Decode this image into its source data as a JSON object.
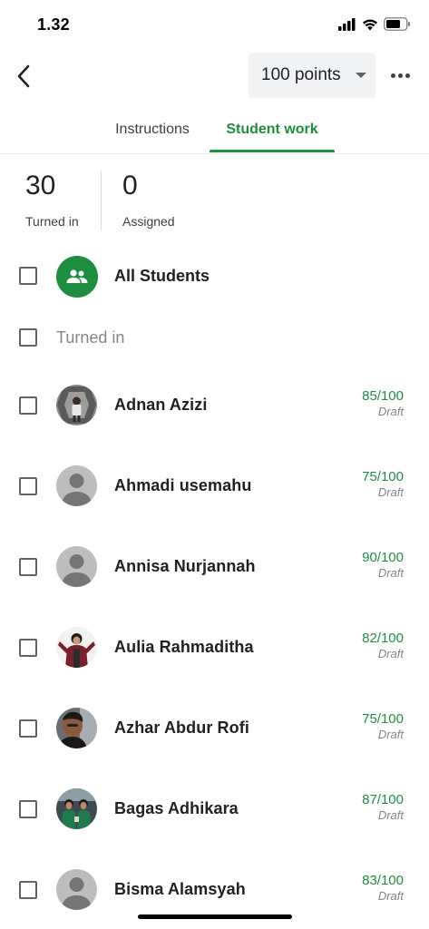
{
  "status_bar": {
    "time": "1.32",
    "signal_icon": "cellular-signal-icon",
    "wifi_icon": "wifi-icon",
    "battery_icon": "battery-icon"
  },
  "top_bar": {
    "back_icon": "back-arrow-icon",
    "points_label": "100 points",
    "dropdown_icon": "chevron-down-icon",
    "more_icon": "more-horizontal-icon"
  },
  "tabs": [
    {
      "label": "Instructions",
      "active": false
    },
    {
      "label": "Student work",
      "active": true
    }
  ],
  "stats": {
    "turned_in": {
      "value": "30",
      "label": "Turned in"
    },
    "assigned": {
      "value": "0",
      "label": "Assigned"
    }
  },
  "all_students": {
    "label": "All Students",
    "icon": "group-icon"
  },
  "section": {
    "label": "Turned in"
  },
  "students": [
    {
      "name": "Adnan Azizi",
      "grade": "85/100",
      "status": "Draft",
      "avatar": "photo"
    },
    {
      "name": "Ahmadi usemahu",
      "grade": "75/100",
      "status": "Draft",
      "avatar": "default"
    },
    {
      "name": "Annisa Nurjannah",
      "grade": "90/100",
      "status": "Draft",
      "avatar": "default"
    },
    {
      "name": "Aulia Rahmaditha",
      "grade": "82/100",
      "status": "Draft",
      "avatar": "photo"
    },
    {
      "name": "Azhar Abdur Rofi",
      "grade": "75/100",
      "status": "Draft",
      "avatar": "photo"
    },
    {
      "name": "Bagas Adhikara",
      "grade": "87/100",
      "status": "Draft",
      "avatar": "photo"
    },
    {
      "name": "Bisma Alamsyah",
      "grade": "83/100",
      "status": "Draft",
      "avatar": "default"
    }
  ],
  "colors": {
    "accent": "#1e8e3e",
    "text": "#202124",
    "muted": "#80868b"
  }
}
